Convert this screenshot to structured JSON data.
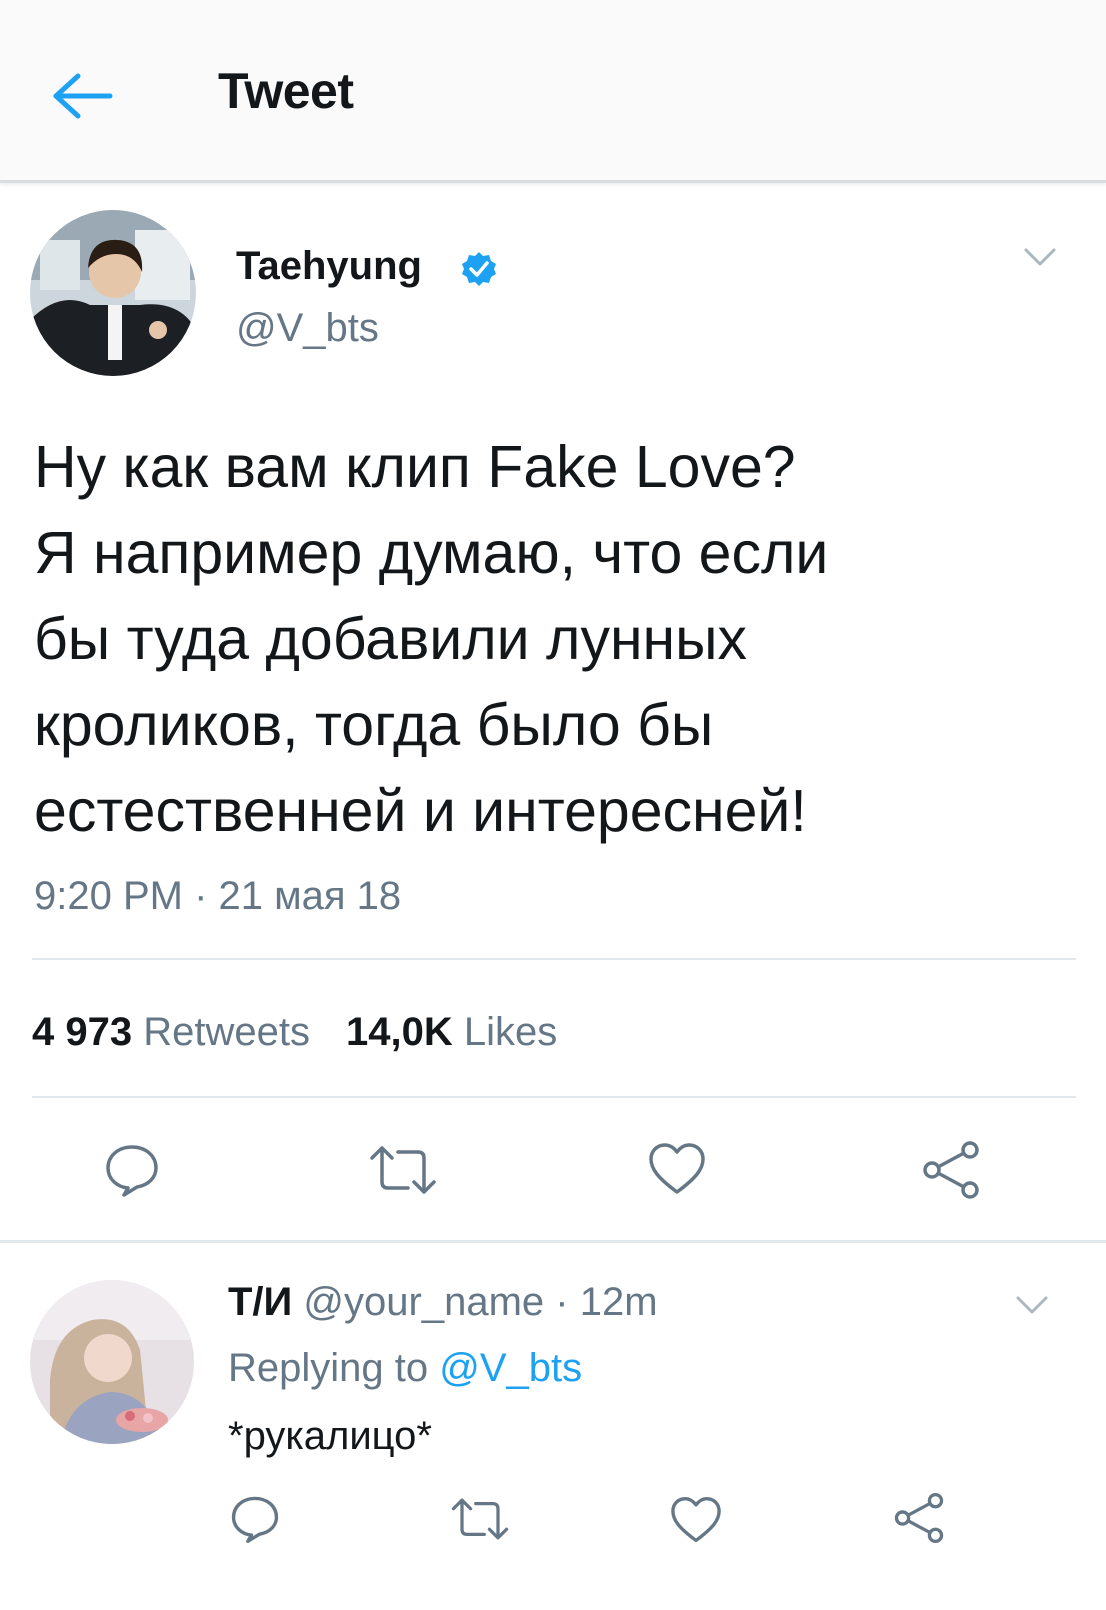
{
  "header": {
    "title": "Tweet",
    "accent_color": "#1da1f2"
  },
  "tweet": {
    "author_name": "Taehyung",
    "author_handle": "@V_bts",
    "verified": true,
    "text_lines": [
      "Ну как вам клип Fake Love?",
      "Я например думаю, что если",
      "бы туда добавили лунных",
      "кроликов, тогда было бы",
      "естественней и интересней!"
    ],
    "timestamp": "9:20 PM · 21 мая 18",
    "retweets_count": "4 973",
    "retweets_label": "Retweets",
    "likes_count": "14,0K",
    "likes_label": "Likes",
    "actions": [
      "reply-icon",
      "retweet-icon",
      "like-icon",
      "share-icon"
    ]
  },
  "reply": {
    "author_name": "Т/И",
    "author_handle": "@your_name",
    "separator": "·",
    "time": "12m",
    "replying_prefix": "Replying to",
    "replying_to": "@V_bts",
    "text": "*рукалицо*",
    "actions": [
      "reply-icon",
      "retweet-icon",
      "like-icon",
      "share-icon"
    ]
  },
  "colors": {
    "text_primary": "#14171a",
    "text_secondary": "#657786",
    "accent": "#1da1f2",
    "divider": "#e1e8ed"
  }
}
